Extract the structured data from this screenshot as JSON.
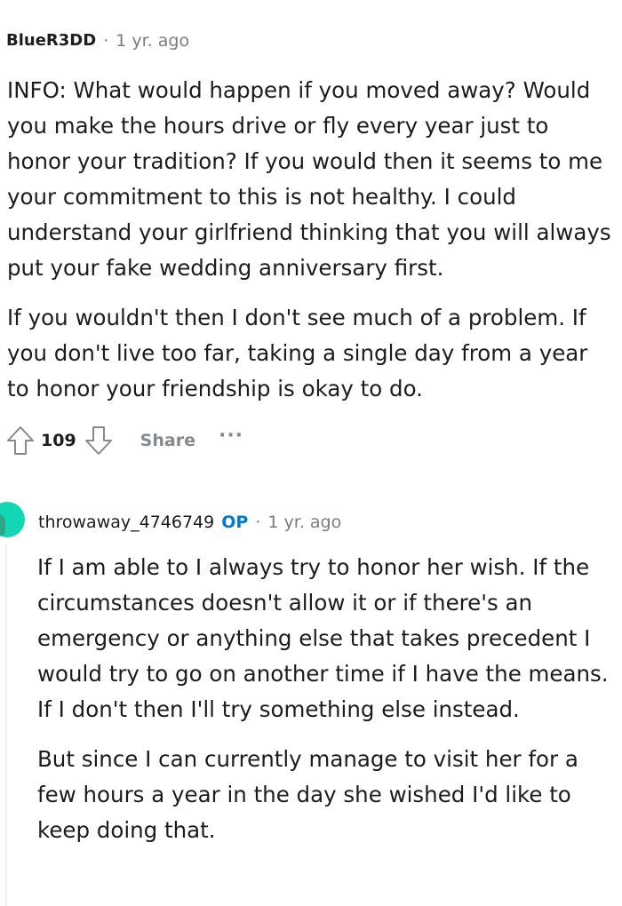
{
  "comments": [
    {
      "username": "BlueR3DD",
      "separator": "·",
      "time": "1 yr. ago",
      "paragraphs": [
        "INFO: What would happen if you moved away? Would you make the hours drive or fly every year just to honor your tradition? If you would then it seems to me your commitment to this is not healthy. I could understand your girlfriend thinking that you will always put your fake wedding anniversary first.",
        "If you wouldn't then I don't see much of a problem. If you don't live too far, taking a single day from a year to honor your friendship is okay to do."
      ],
      "score": "109",
      "share_label": "Share",
      "more_label": "···"
    },
    {
      "username": "throwaway_4746749",
      "op_badge": "OP",
      "separator": "·",
      "time": "1 yr. ago",
      "paragraphs": [
        "If I am able to I always try to honor her wish. If the circumstances doesn't allow it or if there's an emergency or anything else that takes precedent I would try to go on another time if I have the means. If I don't then I'll try something else instead.",
        "But since I can currently manage to visit her for a few hours a year in the day she wished I'd like to keep doing that."
      ]
    }
  ],
  "icons": {
    "upvote": "upvote-arrow-icon",
    "downvote": "downvote-arrow-icon",
    "avatar": "user-avatar"
  },
  "colors": {
    "op_badge": "#0079d3",
    "meta_text": "#7c7c7c",
    "action_text": "#878a8c",
    "avatar_bg": "#13d6b4"
  }
}
